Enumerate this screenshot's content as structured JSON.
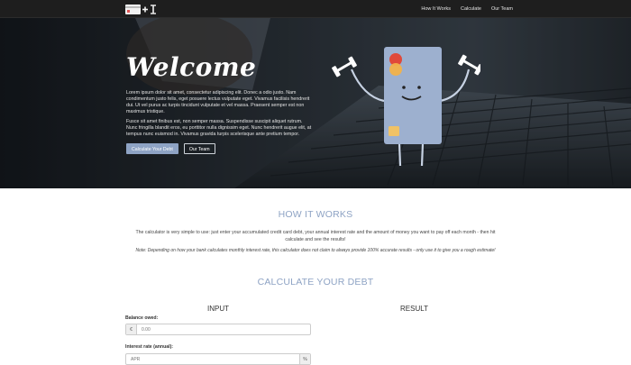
{
  "nav": {
    "links": [
      "How It Works",
      "Calculate",
      "Our Team"
    ]
  },
  "hero": {
    "title": "Welcome",
    "paragraph1": "Lorem ipsum dolor sit amet, consectetur adipiscing elit. Donec a odio justo. Nam condimentum justo felis, eget posuere lectus vulputate eget. Vivamus facilisis hendrerit dui. Ut vel purus ac turpis tincidunt vulputate et vel massa. Praesent semper est non maximus tristique.",
    "paragraph2": "Fusce sit amet finibus est, non semper massa. Suspendisse suscipit aliquet rutrum. Nunc fringilla blandit eros, eu porttitor nulla dignissim eget. Nunc hendrerit augue elit, at tempus nunc euismod in. Vivamus gravida turpis scelerisque ante pretium tempor.",
    "primary_button": "Calculate Your Debt",
    "secondary_button": "Our Team"
  },
  "how": {
    "title": "HOW IT WORKS",
    "text": "The calculator is very simple to use: just enter your accumulated credit card debt, your annual interest rate and the amount of money you want to pay off each month - then hit calculate and see the results!",
    "note": "Note: Depending on how your bank calculates monthly interest rate, this calculator does not claim to always provide 100% accurate results - only use it to give you a rough estimate!"
  },
  "calc": {
    "title": "CALCULATE YOUR DEBT",
    "input_heading": "INPUT",
    "result_heading": "RESULT",
    "balance_label": "Balance owed:",
    "balance_addon": "€",
    "balance_placeholder": "0.00",
    "interest_label": "Interest rate (annual):",
    "interest_placeholder": "APR",
    "interest_addon": "%"
  },
  "colors": {
    "accent": "#8ea3c4",
    "nav_bg": "#1e1e1e",
    "card_body": "#9db0cf"
  }
}
